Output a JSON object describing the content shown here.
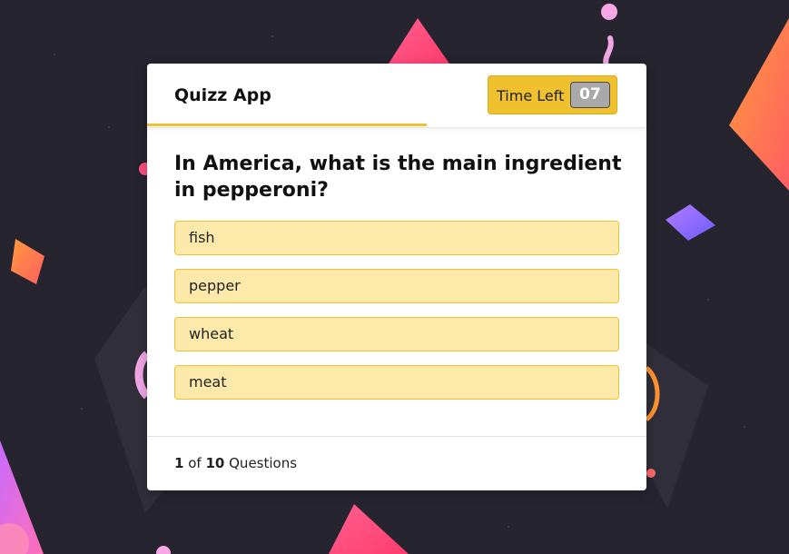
{
  "app": {
    "title": "Quizz App"
  },
  "timer": {
    "label": "Time Left",
    "value": "07",
    "progress": 0.56
  },
  "question": {
    "text": "In America, what is the main ingredient in pepperoni?"
  },
  "options": [
    {
      "label": "fish"
    },
    {
      "label": "pepper"
    },
    {
      "label": "wheat"
    },
    {
      "label": "meat"
    }
  ],
  "footer": {
    "current": "1",
    "of": "of",
    "total": "10",
    "suffix": "Questions"
  },
  "colors": {
    "background": "#26242f",
    "accent": "#f0c12e",
    "option_bg": "#fde9aa",
    "card": "#ffffff"
  }
}
